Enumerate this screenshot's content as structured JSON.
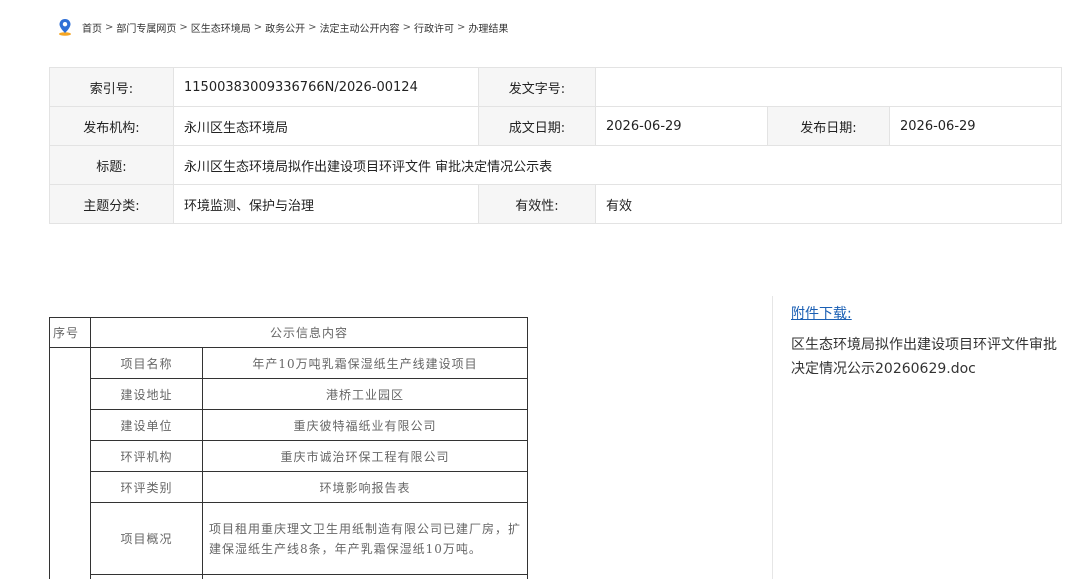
{
  "breadcrumb": {
    "items": [
      "首页",
      "部门专属网页",
      "区生态环境局",
      "政务公开",
      "法定主动公开内容",
      "行政许可",
      "办理结果"
    ],
    "separator": ">"
  },
  "meta": {
    "index_label": "索引号:",
    "index_value": "11500383009336766N/2026-00124",
    "docno_label": "发文字号:",
    "docno_value": "",
    "publisher_label": "发布机构:",
    "publisher_value": "永川区生态环境局",
    "created_label": "成文日期:",
    "created_value": "2026-06-29",
    "published_label": "发布日期:",
    "published_value": "2026-06-29",
    "title_label": "标题:",
    "title_value": "永川区生态环境局拟作出建设项目环评文件 审批决定情况公示表",
    "topic_label": "主题分类:",
    "topic_value": "环境监测、保护与治理",
    "validity_label": "有效性:",
    "validity_value": "有效"
  },
  "notice": {
    "seq_header": "序号",
    "content_header": "公示信息内容",
    "rows": [
      {
        "label": "项目名称",
        "value": "年产10万吨乳霜保湿纸生产线建设项目"
      },
      {
        "label": "建设地址",
        "value": "港桥工业园区"
      },
      {
        "label": "建设单位",
        "value": "重庆彼特福纸业有限公司"
      },
      {
        "label": "环评机构",
        "value": "重庆市诚治环保工程有限公司"
      },
      {
        "label": "环评类别",
        "value": "环境影响报告表"
      },
      {
        "label": "项目概况",
        "value": "项目租用重庆理文卫生用纸制造有限公司已建厂房，扩建保湿纸生产线8条，年产乳霜保湿纸10万吨。"
      }
    ]
  },
  "attachment": {
    "title": "附件下载:",
    "file_name": "区生态环境局拟作出建设项目环评文件审批决定情况公示20260629.doc"
  },
  "colors": {
    "link": "#1a5fb4",
    "location_icon_blue": "#2f6fd6",
    "location_icon_orange": "#f5a623"
  }
}
